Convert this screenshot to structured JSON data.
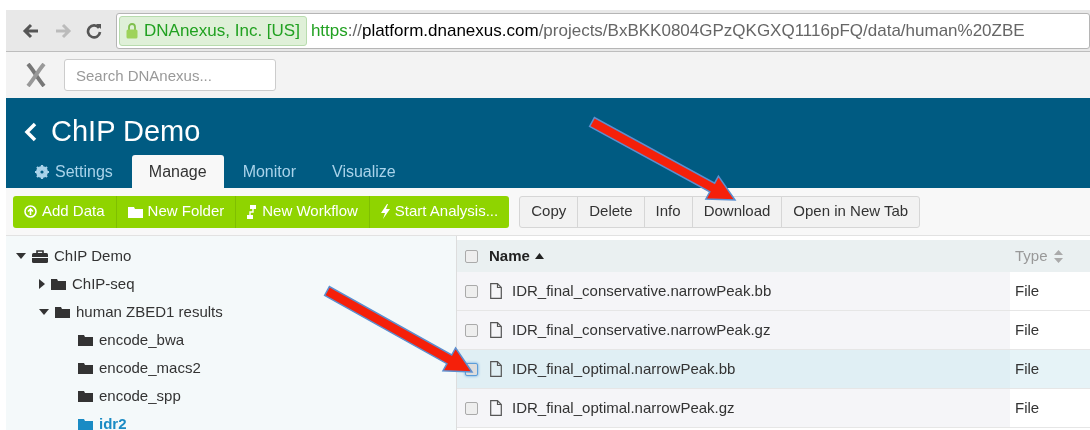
{
  "browser": {
    "security_badge": "DNAnexus, Inc. [US]",
    "url": {
      "scheme": "https",
      "separator": "://",
      "host": "platform.dnanexus.com",
      "path": "/projects/BxBKK0804GPzQKGXQ1116pFQ/data/human%20ZBE"
    }
  },
  "app_bar": {
    "search": {
      "placeholder": "Search DNAnexus..."
    }
  },
  "project": {
    "title": "ChIP Demo"
  },
  "tabs": [
    {
      "label": "Settings",
      "selected": false
    },
    {
      "label": "Manage",
      "selected": true
    },
    {
      "label": "Monitor",
      "selected": false
    },
    {
      "label": "Visualize",
      "selected": false
    }
  ],
  "primary_actions": [
    "Add Data",
    "New Folder",
    "New Workflow",
    "Start Analysis..."
  ],
  "file_actions": [
    "Copy",
    "Delete",
    "Info",
    "Download",
    "Open in New Tab"
  ],
  "folder_tree": [
    {
      "label": "ChIP Demo",
      "kind": "project",
      "expanded": true,
      "selected": false,
      "children": [
        {
          "label": "ChIP-seq",
          "kind": "folder",
          "expanded": false,
          "selected": false
        },
        {
          "label": "human ZBED1 results",
          "kind": "folder",
          "expanded": true,
          "selected": false,
          "children": [
            {
              "label": "encode_bwa",
              "kind": "folder",
              "selected": false
            },
            {
              "label": "encode_macs2",
              "kind": "folder",
              "selected": false
            },
            {
              "label": "encode_spp",
              "kind": "folder",
              "selected": false
            },
            {
              "label": "idr2",
              "kind": "folder",
              "selected": true
            }
          ]
        }
      ]
    }
  ],
  "table": {
    "columns": [
      {
        "label": "Name",
        "kind": "sorted"
      },
      {
        "label": "Type",
        "kind": "sortable"
      }
    ],
    "header_checkbox": {
      "checked": false
    },
    "rows": [
      {
        "name": "IDR_final_conservative.narrowPeak.bb",
        "type": "File",
        "selected": false
      },
      {
        "name": "IDR_final_conservative.narrowPeak.gz",
        "type": "File",
        "selected": false
      },
      {
        "name": "IDR_final_optimal.narrowPeak.bb",
        "type": "File",
        "selected": true
      },
      {
        "name": "IDR_final_optimal.narrowPeak.gz",
        "type": "File",
        "selected": false
      }
    ]
  },
  "annotations": [
    {
      "kind": "arrow"
    },
    {
      "kind": "arrow"
    }
  ]
}
